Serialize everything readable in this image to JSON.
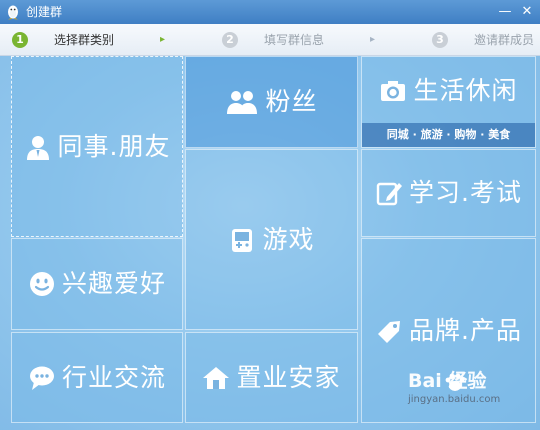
{
  "window": {
    "title": "创建群",
    "minimize": "—",
    "close": "✕"
  },
  "steps": [
    {
      "number": "1",
      "label": "选择群类别",
      "state": "active"
    },
    {
      "number": "2",
      "label": "填写群信息",
      "state": "inactive"
    },
    {
      "number": "3",
      "label": "邀请群成员",
      "state": "inactive"
    }
  ],
  "step_arrows": [
    "▸",
    "▸"
  ],
  "colors": {
    "title_bar": "#4a8acc",
    "active_step": "#7ab532",
    "tile_light": "#8fc4ec",
    "tile_dark": "#58a0de"
  },
  "tiles": {
    "colleagues": {
      "label": "同事.朋友",
      "icon": "person-icon"
    },
    "fans": {
      "label": "粉丝",
      "icon": "people-icon"
    },
    "life": {
      "label": "生活休闲",
      "icon": "camera-icon",
      "sub": "同城 · 旅游 · 购物 · 美食"
    },
    "games": {
      "label": "游戏",
      "icon": "gamepad-icon"
    },
    "study": {
      "label": "学习.考试",
      "icon": "pencil-icon"
    },
    "hobbies": {
      "label": "兴趣爱好",
      "icon": "smiley-icon"
    },
    "brands": {
      "label": "品牌.产品",
      "icon": "tag-icon"
    },
    "industry": {
      "label": "行业交流",
      "icon": "chat-icon"
    },
    "realestate": {
      "label": "置业安家",
      "icon": "house-icon"
    }
  },
  "watermark": {
    "brand": "Bai  经验",
    "url": "jingyan.baidu.com"
  }
}
